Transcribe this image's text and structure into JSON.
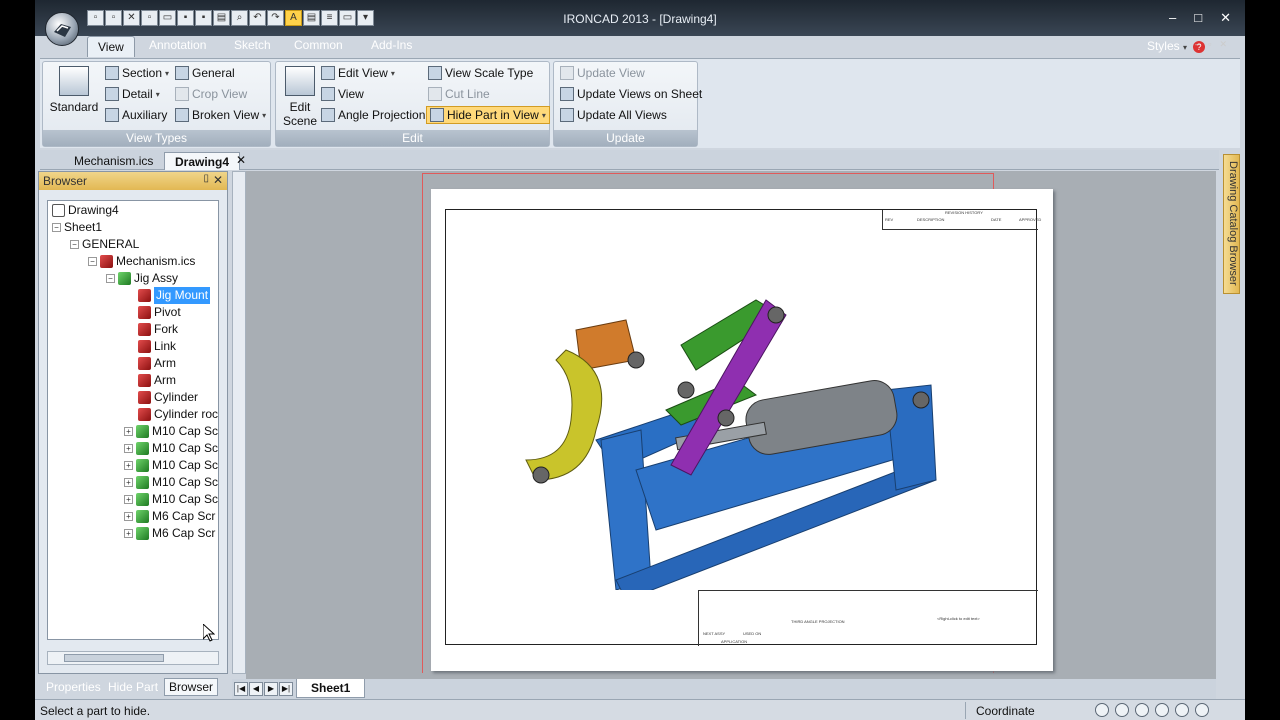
{
  "app": {
    "title": "IRONCAD 2013 - [Drawing4]",
    "window_controls": [
      "–",
      "□",
      "✕"
    ]
  },
  "ribbon_tabs": [
    "View",
    "Annotation",
    "Sketch",
    "Common",
    "Add-Ins"
  ],
  "styles_label": "Styles",
  "groups": {
    "view_types": {
      "name": "View Types",
      "standard": "Standard",
      "section": "Section",
      "detail": "Detail",
      "auxiliary": "Auxiliary",
      "general": "General",
      "crop_view": "Crop View",
      "broken_view": "Broken View"
    },
    "edit": {
      "name": "Edit",
      "edit_scene_1": "Edit",
      "edit_scene_2": "Scene",
      "edit_view": "Edit View",
      "view": "View",
      "angle_projection": "Angle Projection",
      "view_scale_type": "View Scale Type",
      "cut_line": "Cut Line",
      "hide_part_in_view": "Hide Part in View"
    },
    "update": {
      "name": "Update",
      "update_view": "Update View",
      "update_views_on_sheet": "Update Views on Sheet",
      "update_all_views": "Update All Views"
    }
  },
  "doc_tabs": [
    "Mechanism.ics",
    "Drawing4"
  ],
  "browser": {
    "title": "Browser",
    "tree": [
      "Drawing4",
      "Sheet1",
      "GENERAL",
      "Mechanism.ics",
      "Jig Assy",
      "Jig Mount",
      "Pivot",
      "Fork",
      "Link",
      "Arm",
      "Arm",
      "Cylinder",
      "Cylinder roc",
      "M10 Cap Sc",
      "M10 Cap Sc",
      "M10 Cap Sc",
      "M10 Cap Sc",
      "M10 Cap Sc",
      "M6 Cap Scr",
      "M6 Cap Scr"
    ]
  },
  "bottom_tabs": [
    "Properties",
    "Hide Part",
    "Browser"
  ],
  "right_dock": "Drawing Catalog Browser",
  "sheet_tab": "Sheet1",
  "drawing": {
    "revision_history": "REVISION HISTORY",
    "rev_cols": [
      "REV",
      "DESCRIPTION",
      "DATE",
      "APPROVED"
    ],
    "third_angle": "THIRD ANGLE PROJECTION",
    "right_click_note": "<Right-click to edit text>",
    "next_assy": "NEXT ASSY",
    "used_on": "USED ON",
    "application": "APPLICATION"
  },
  "status": {
    "message": "Select a part to hide.",
    "coordinate": "Coordinate"
  },
  "colors": {
    "highlight": "#ffd97a",
    "selection": "#3399ff",
    "browser_header": "#e2b853"
  }
}
